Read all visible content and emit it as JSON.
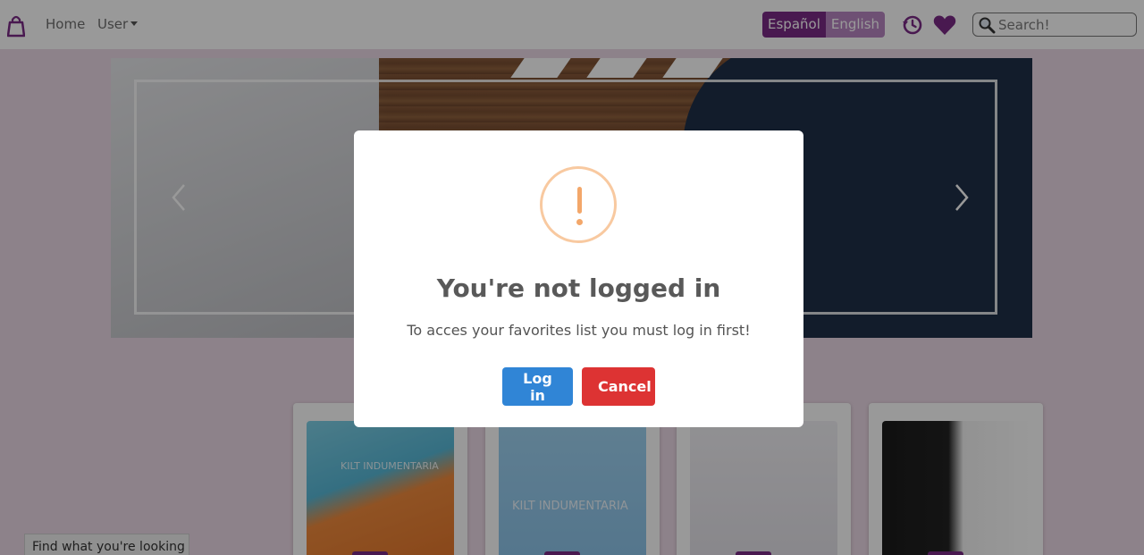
{
  "navbar": {
    "brand_icon": "shopping-bag-icon",
    "home_label": "Home",
    "user_label": "User",
    "languages": [
      "Español",
      "English"
    ],
    "active_language": "Español",
    "history_icon": "history-icon",
    "favorites_icon": "heart-icon",
    "search_placeholder": "Search!",
    "accent_color": "#7b2a86"
  },
  "carousel": {
    "prev_icon": "chevron-left-icon",
    "next_icon": "chevron-right-icon"
  },
  "products": [
    {
      "watermark": "KILT INDUMENTARIA"
    },
    {
      "watermark": "KILT INDUMENTARIA"
    },
    {
      "watermark": ""
    },
    {
      "watermark": ""
    }
  ],
  "find_tab": {
    "label": "Find what you're looking"
  },
  "modal": {
    "icon": "warning-icon",
    "title": "You're not logged in",
    "text": "To acces your favorites list you must log in first!",
    "confirm_label": "Log in",
    "cancel_label": "Cancel",
    "confirm_color": "#3085d6",
    "cancel_color": "#dd3333"
  }
}
